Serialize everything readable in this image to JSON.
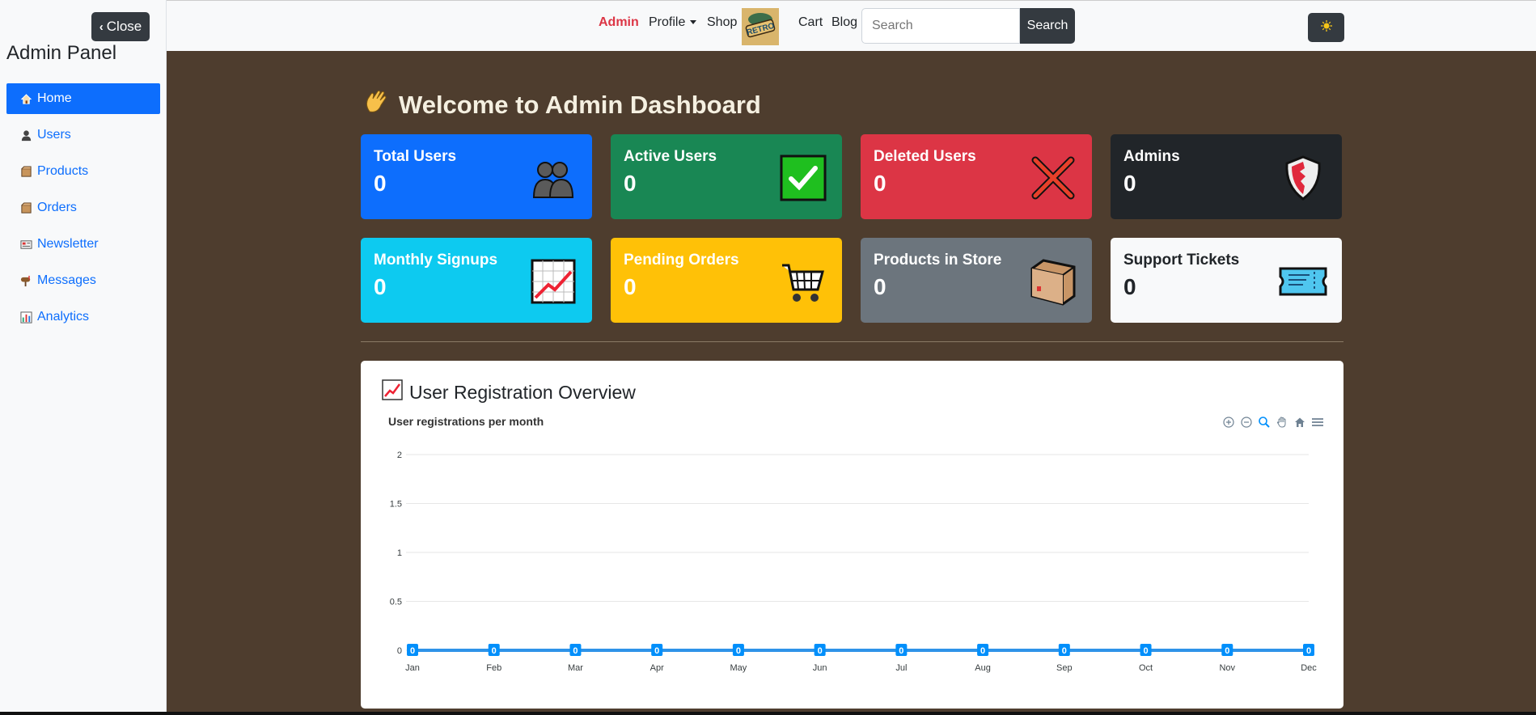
{
  "sidebar": {
    "close_label": "Close",
    "title": "Admin Panel",
    "items": [
      {
        "label": "Home",
        "icon": "house-icon",
        "active": true
      },
      {
        "label": "Users",
        "icon": "user-icon"
      },
      {
        "label": "Products",
        "icon": "box-icon"
      },
      {
        "label": "Orders",
        "icon": "box-icon"
      },
      {
        "label": "Newsletter",
        "icon": "newspaper-icon"
      },
      {
        "label": "Messages",
        "icon": "mailbox-icon"
      },
      {
        "label": "Analytics",
        "icon": "bar-chart-icon"
      }
    ]
  },
  "topbar": {
    "admin": "Admin",
    "profile": "Profile",
    "shop": "Shop",
    "logo_text": "RETRO",
    "cart": "Cart",
    "blog": "Blog",
    "search_placeholder": "Search",
    "search_button": "Search",
    "theme_icon": "sun-icon"
  },
  "main": {
    "welcome": "Welcome to Admin Dashboard",
    "cards": [
      {
        "title": "Total Users",
        "value": "0",
        "icon": "people-icon",
        "bg": "#0d6efd",
        "fg": "#ffffff"
      },
      {
        "title": "Active Users",
        "value": "0",
        "icon": "check-icon",
        "bg": "#198754",
        "fg": "#ffffff"
      },
      {
        "title": "Deleted Users",
        "value": "0",
        "icon": "cross-icon",
        "bg": "#dc3545",
        "fg": "#ffffff"
      },
      {
        "title": "Admins",
        "value": "0",
        "icon": "shield-icon",
        "bg": "#212529",
        "fg": "#ffffff"
      },
      {
        "title": "Monthly Signups",
        "value": "0",
        "icon": "trend-chart-icon",
        "bg": "#0dcaf0",
        "fg": "#ffffff"
      },
      {
        "title": "Pending Orders",
        "value": "0",
        "icon": "cart-icon",
        "bg": "#ffc107",
        "fg": "#ffffff"
      },
      {
        "title": "Products in Store",
        "value": "0",
        "icon": "box-icon",
        "bg": "#6c757d",
        "fg": "#ffffff"
      },
      {
        "title": "Support Tickets",
        "value": "0",
        "icon": "ticket-icon",
        "bg": "#f8f9fa",
        "fg": "#212529"
      }
    ],
    "chart_heading": "User Registration Overview"
  },
  "colors": {
    "page_bg": "#4e3d2e",
    "accent": "#0d6efd",
    "line": "#2e93e8"
  },
  "chart_data": {
    "type": "line",
    "title": "User registrations per month",
    "categories": [
      "Jan",
      "Feb",
      "Mar",
      "Apr",
      "May",
      "Jun",
      "Jul",
      "Aug",
      "Sep",
      "Oct",
      "Nov",
      "Dec"
    ],
    "series": [
      {
        "values": [
          0,
          0,
          0,
          0,
          0,
          0,
          0,
          0,
          0,
          0,
          0,
          0
        ]
      }
    ],
    "y_ticks": [
      "0",
      "0.5",
      "1",
      "1.5",
      "2"
    ],
    "ylim": [
      0,
      2
    ],
    "grid": true,
    "data_labels": true,
    "toolbar": [
      "zoom-in-icon",
      "zoom-out-icon",
      "magnifier-icon",
      "pan-hand-icon",
      "home-icon",
      "menu-icon"
    ]
  }
}
